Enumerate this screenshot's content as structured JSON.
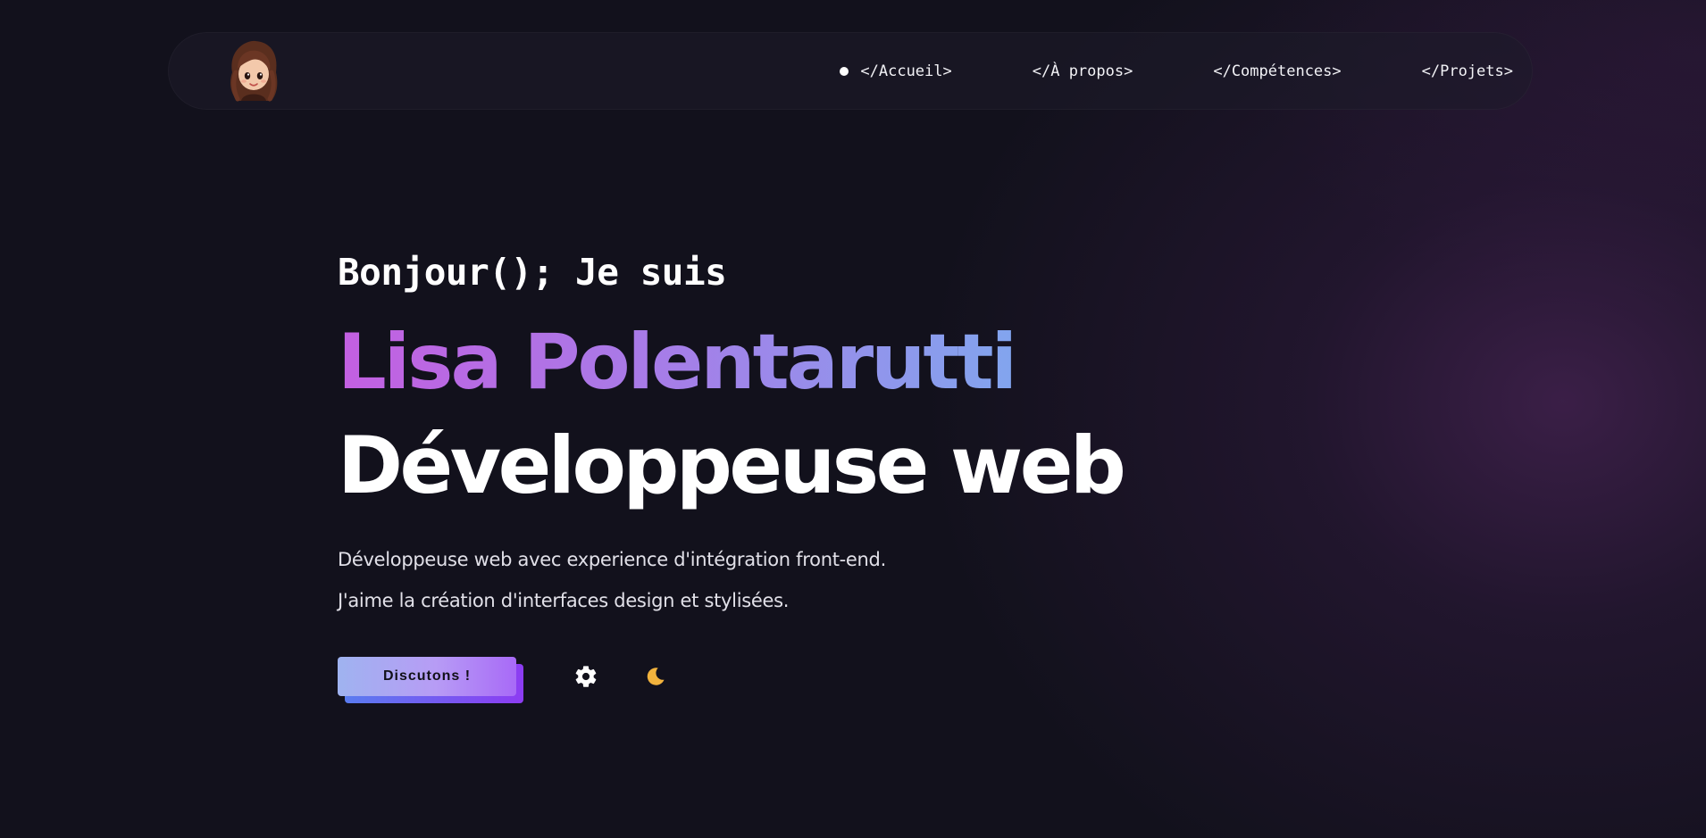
{
  "navbar": {
    "avatar_icon": "girl-avatar-icon",
    "links": [
      {
        "label": "</Accueil>",
        "active": true
      },
      {
        "label": "</À propos>",
        "active": false
      },
      {
        "label": "</Compétences>",
        "active": false
      },
      {
        "label": "</Projets>",
        "active": false
      }
    ]
  },
  "hero": {
    "greeting": "Bonjour(); Je suis",
    "name": "Lisa Polentarutti",
    "role": "Développeuse web",
    "description_line1": "Développeuse web avec experience d'intégration front-end.",
    "description_line2": "J'aime la création d'interfaces design et stylisées."
  },
  "actions": {
    "cta_label": "Discutons !",
    "settings_icon": "gear-icon",
    "theme_icon": "moon-icon"
  },
  "colors": {
    "background": "#12111c",
    "accent_gradient_start": "#c35fe1",
    "accent_gradient_end": "#82a5ee",
    "moon": "#f2b33d"
  }
}
